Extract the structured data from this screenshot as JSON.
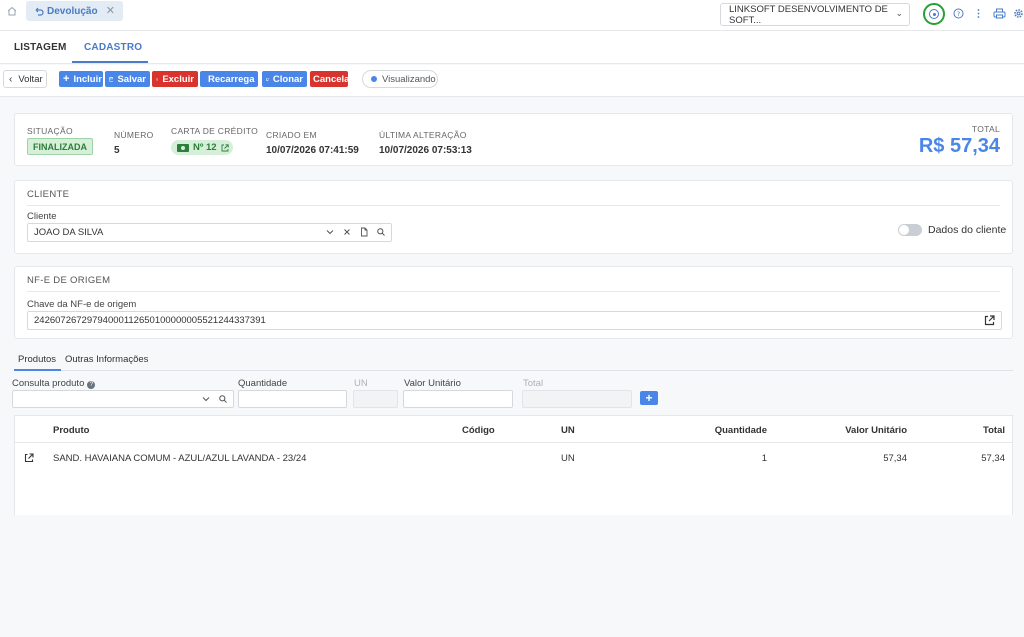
{
  "topbar": {
    "home_icon": "home-icon",
    "open_tab_label": "Devolução",
    "open_tab_icon": "undo-icon",
    "company_select": "LINKSOFT DESENVOLVIMENTO DE SOFT...",
    "icons": [
      "target-icon",
      "help-icon",
      "more-vertical-icon",
      "printer-icon",
      "gear-icon"
    ]
  },
  "page_tabs": {
    "list": "LISTAGEM",
    "form": "CADASTRO",
    "active": "CADASTRO"
  },
  "toolbar": {
    "back": "Voltar",
    "add": "Incluir",
    "save": "Salvar",
    "delete": "Excluir",
    "reload": "Recarrega",
    "clone": "Clonar",
    "cancel": "Cancelar",
    "status": "Visualizando"
  },
  "colors": {
    "primary": "#4a86e8",
    "danger": "#d9332e",
    "success_bg": "#d5efd9",
    "success_text": "#2e7d3a",
    "highlight_ring": "#27a035"
  },
  "summary": {
    "status_label": "SITUAÇÃO",
    "status_value": "FINALIZADA",
    "number_label": "NÚMERO",
    "number_value": "5",
    "credit_label": "CARTA DE CRÉDITO",
    "credit_value": "Nº 12",
    "created_label": "CRIADO EM",
    "created_value": "10/07/2026 07:41:59",
    "updated_label": "ÚLTIMA ALTERAÇÃO",
    "updated_value": "10/07/2026 07:53:13",
    "total_label": "TOTAL",
    "total_value": "R$ 57,34"
  },
  "cliente": {
    "section_title": "CLIENTE",
    "field_label": "Cliente",
    "value": "JOAO DA SILVA",
    "toggle_label": "Dados do cliente",
    "toggle_on": false
  },
  "nfe": {
    "section_title": "NF-E DE ORIGEM",
    "field_label": "Chave da NF-e de origem",
    "value": "24260726729794000112650100000005521244337391"
  },
  "product_tabs": {
    "products": "Produtos",
    "other": "Outras Informações",
    "active": "Produtos"
  },
  "product_form": {
    "search_label": "Consulta produto",
    "qty_label": "Quantidade",
    "unit_label": "UN",
    "price_label": "Valor Unitário",
    "total_label": "Total",
    "add_button": "+"
  },
  "table": {
    "columns": [
      "Produto",
      "Código",
      "UN",
      "Quantidade",
      "Valor Unitário",
      "Total"
    ],
    "rows": [
      {
        "produto": "SAND. HAVAIANA COMUM - AZUL/AZUL LAVANDA - 23/24",
        "codigo": "",
        "un": "UN",
        "quantidade": "1",
        "valor_unitario": "57,34",
        "total": "57,34"
      }
    ]
  }
}
